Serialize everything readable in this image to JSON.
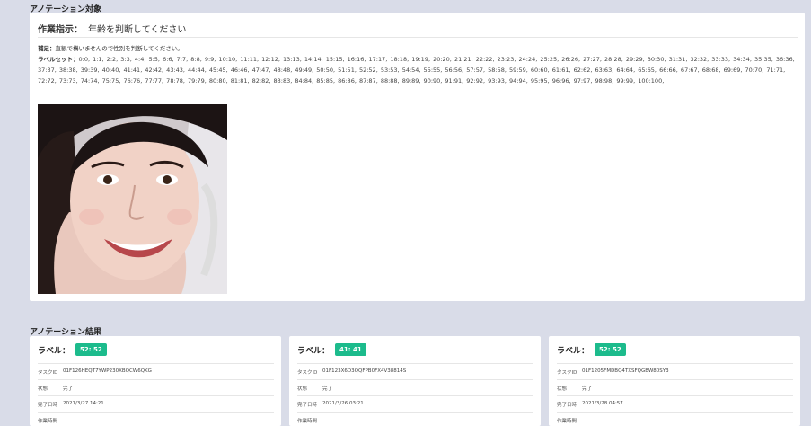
{
  "target_section": {
    "title": "アノテーション対象",
    "instruction_label": "作業指示：",
    "instruction_text": "年齢を判断してください",
    "note_label": "補足：",
    "note_text": "直観で構いませんので性別を判断してください。",
    "labelset_label": "ラベルセット：",
    "labelset_text": "0:0,  1:1,  2:2,  3:3,  4:4,  5:5,  6:6,  7:7,  8:8,  9:9,  10:10,  11:11,  12:12,  13:13,  14:14,  15:15,  16:16,  17:17,  18:18,  19:19,  20:20,  21:21,  22:22,  23:23,  24:24,  25:25,  26:26,  27:27,  28:28,  29:29,  30:30,  31:31,  32:32,  33:33,  34:34,  35:35,  36:36,  37:37,  38:38,  39:39,  40:40,  41:41,  42:42,  43:43,  44:44,  45:45,  46:46,  47:47,  48:48,  49:49,  50:50,  51:51,  52:52,  53:53,  54:54,  55:55,  56:56,  57:57,  58:58,  59:59,  60:60,  61:61,  62:62,  63:63,  64:64,  65:65,  66:66,  67:67,  68:68,  69:69,  70:70,  71:71,  72:72,  73:73,  74:74,  75:75,  76:76,  77:77,  78:78,  79:79,  80:80,  81:81,  82:82,  83:83,  84:84,  85:85,  86:86,  87:87,  88:88,  89:89,  90:90,  91:91,  92:92,  93:93,  94:94,  95:95,  96:96,  97:97,  98:98,  99:99,  100:100,"
  },
  "results_section": {
    "title": "アノテーション結果",
    "cards": [
      {
        "label_title": "ラベル：",
        "badge": "52: 52",
        "task_id_key": "タスクID",
        "task_id": "01F126HEQT7YWP230XBQCW6QKG",
        "status_key": "状態",
        "status": "完了",
        "done_key": "完了日時",
        "done": "2021/3/27 14:21",
        "extra_key": "作業時間"
      },
      {
        "label_title": "ラベル：",
        "badge": "41: 41",
        "task_id_key": "タスクID",
        "task_id": "01F123X6D3QQFPB0FX4V38814S",
        "status_key": "状態",
        "status": "完了",
        "done_key": "完了日時",
        "done": "2021/3/26 03:21",
        "extra_key": "作業時間"
      },
      {
        "label_title": "ラベル：",
        "badge": "52: 52",
        "task_id_key": "タスクID",
        "task_id": "01F1205FMDBQ4TXSFQGBW80SY3",
        "status_key": "状態",
        "status": "完了",
        "done_key": "完了日時",
        "done": "2021/3/28 04:57",
        "extra_key": "作業時間"
      }
    ]
  },
  "colors": {
    "badge": "#1cbb8c",
    "background": "#d9dce8"
  }
}
